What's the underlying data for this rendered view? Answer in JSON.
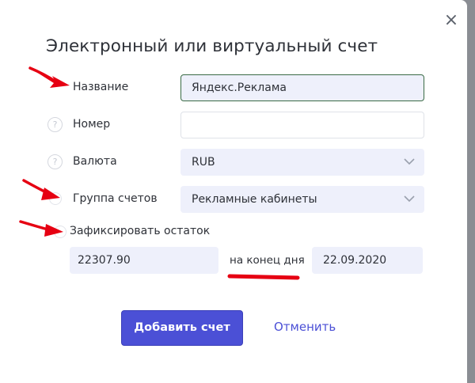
{
  "dialog": {
    "title": "Электронный или виртуальный счет",
    "close_icon": "×"
  },
  "form": {
    "name": {
      "label": "Название",
      "value": "Яндекс.Реклама"
    },
    "number": {
      "label": "Номер",
      "value": ""
    },
    "currency": {
      "label": "Валюта",
      "value": "RUB"
    },
    "group": {
      "label": "Группа счетов",
      "value": "Рекламные кабинеты"
    },
    "fix_balance": {
      "label": "Зафиксировать остаток",
      "amount": "22307.90",
      "at_label": "на конец дня",
      "date": "22.09.2020"
    },
    "help_icon": "?"
  },
  "actions": {
    "submit_label": "Добавить счет",
    "cancel_label": "Отменить"
  },
  "colors": {
    "accent": "#4b50d6",
    "annotation": "#e60012"
  }
}
